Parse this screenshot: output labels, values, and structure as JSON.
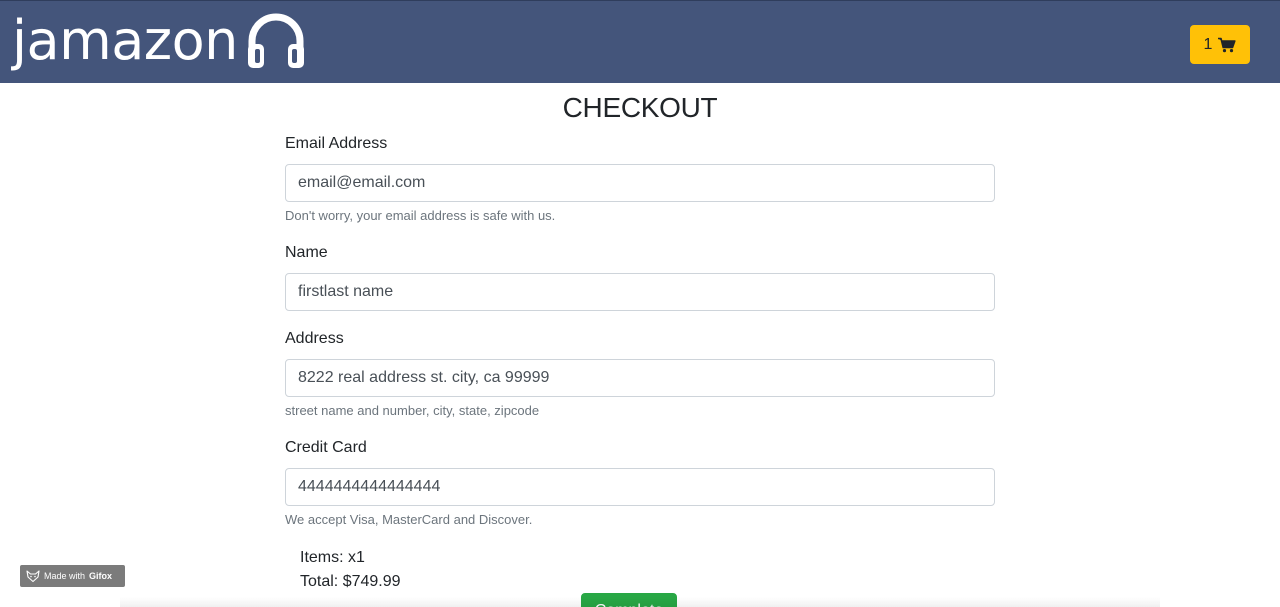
{
  "header": {
    "brand": "jamazon",
    "brand_icon": "headphones-icon",
    "cart_count": "1",
    "cart_icon": "shopping-cart-icon",
    "colors": {
      "navbar": "#44557b",
      "cart_button": "#ffc107"
    }
  },
  "page": {
    "title": "CHECKOUT"
  },
  "form": {
    "email": {
      "label": "Email Address",
      "value": "email@email.com",
      "help": "Don't worry, your email address is safe with us."
    },
    "name": {
      "label": "Name",
      "value": "firstlast name"
    },
    "address": {
      "label": "Address",
      "value": "8222 real address st. city, ca 99999",
      "help": "street name and number, city, state, zipcode"
    },
    "credit_card": {
      "label": "Credit Card",
      "value": "4444444444444444",
      "help": "We accept Visa, MasterCard and Discover."
    }
  },
  "summary": {
    "items": "Items: x1",
    "total": "Total: $749.99"
  },
  "submit": {
    "label": "Complete",
    "color": "#28a745"
  },
  "watermark": {
    "made_with": "Made with",
    "brand": "Gifox"
  }
}
